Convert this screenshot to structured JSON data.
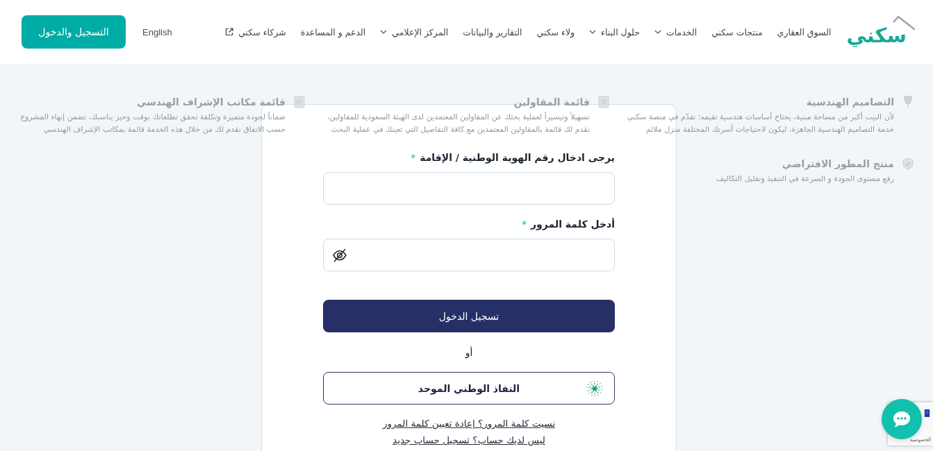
{
  "header": {
    "logo": "سكني",
    "nav": [
      {
        "label": "السوق العقاري",
        "kind": "link"
      },
      {
        "label": "منتجات سكني",
        "kind": "link"
      },
      {
        "label": "الخدمات",
        "kind": "dropdown"
      },
      {
        "label": "حلول البناء",
        "kind": "dropdown"
      },
      {
        "label": "ولاء سكني",
        "kind": "link"
      },
      {
        "label": "التقارير والبيانات",
        "kind": "link"
      },
      {
        "label": "المركز الإعلامي",
        "kind": "dropdown"
      },
      {
        "label": "الدعم و المساعدة",
        "kind": "link"
      },
      {
        "label": "شركاء سكني",
        "kind": "external"
      }
    ],
    "language": "English",
    "register_button": "التسجيل والدخول"
  },
  "features": [
    {
      "kind": "pen",
      "title": "التصاميم الهندسية",
      "description": "لأن البيت أكبر من مساحة مبنية، يحتاج أساسات هندسية تقيمه؛ نقدّم في منصة سكني خدمة التصاميم الهندسية الجاهزة، ليكون لاحتياجات أسرتك المختلفة منزل ملائم"
    },
    {
      "kind": "document",
      "title": "قائمة المقاولين",
      "description": "تسهيلاً وتيسيراً لعملية بحثك عن المقاولين المعتمدين لدى الهيئة السعودية للمقاولين، نقدم لك قائمة بالمقاولين المعتمدين مع كافة التفاصيل التي تعينك في عملية البحث"
    },
    {
      "kind": "document",
      "title": "قائمة مكاتب الإشراف الهندسي",
      "description": "ضماناً لجودة متميزة وتكلفة تحقق تطلعاتك بوقت وحيز يناسبك، تضمن إنهاء المشروع حسب الاتفاق نقدم لك من خلال هذه الخدمة قائمة بمكاتب الإشراف الهندسي"
    },
    {
      "kind": "badge",
      "title": "منتج المطور الافتراضي",
      "description": "رفع مستوى الجودة و السرعة في التنفيذ وتقليل التكاليف"
    }
  ],
  "login_form": {
    "fields": [
      {
        "kind": "text",
        "label": "يرجى ادخال رقم الهوية الوطنية / الإقامة",
        "required_mark": "*"
      },
      {
        "kind": "password",
        "label": "أدخل كلمة المرور",
        "required_mark": "*"
      }
    ],
    "submit_button": "تسجيل الدخول",
    "separator": "أو",
    "nafath_button": "النفاذ الوطني الموحد",
    "links": [
      "نسيت كلمة المرور؟ إعادة تعيين كلمة المرور",
      "ليس لديك حساب؟ تسجيل حساب جديد"
    ]
  },
  "recaptcha": {
    "text": "الخصوصية"
  }
}
